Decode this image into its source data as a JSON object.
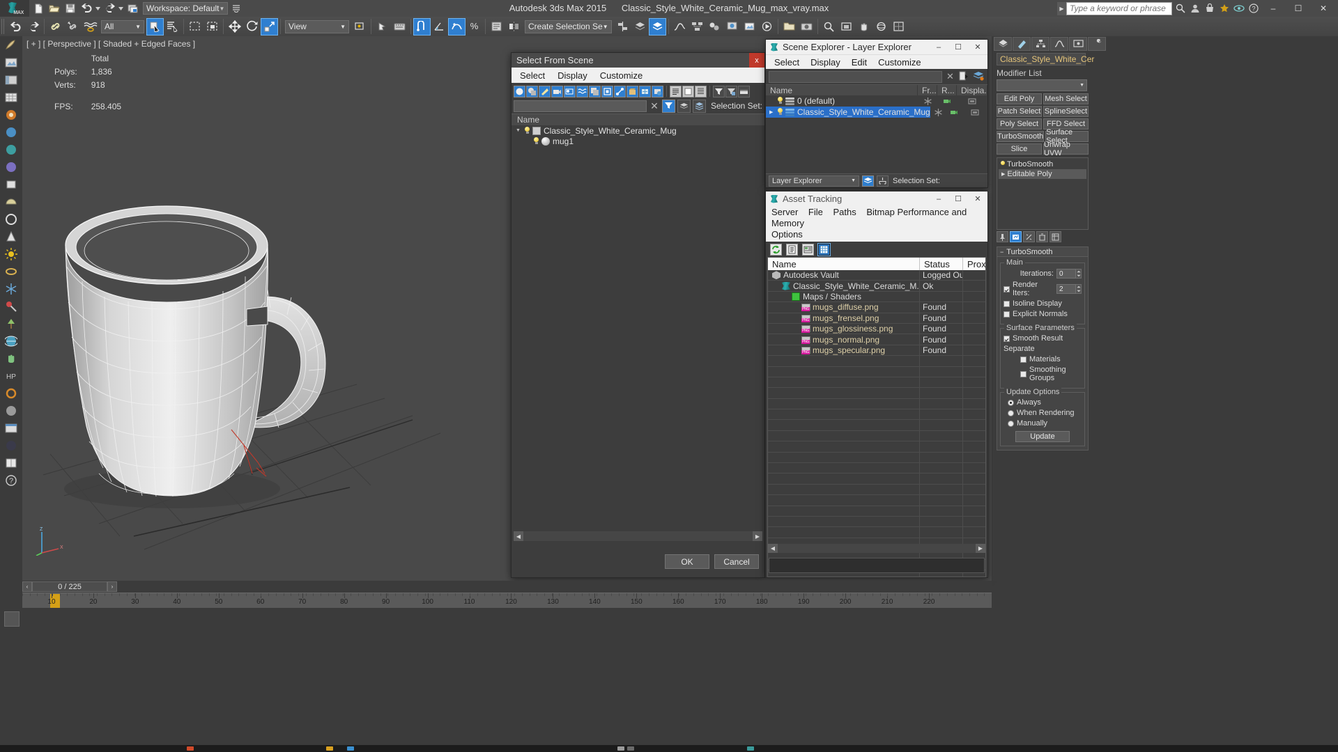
{
  "titlebar": {
    "workspace": "Workspace: Default",
    "product": "Autodesk 3ds Max  2015",
    "file": "Classic_Style_White_Ceramic_Mug_max_vray.max",
    "search_placeholder": "Type a keyword or phrase",
    "min": "–",
    "max": "☐",
    "close": "✕"
  },
  "toolbar": {
    "selection_filter": "All",
    "view_combo": "View",
    "named_selection_set": "Create Selection Se"
  },
  "viewport": {
    "label": "[ + ] [ Perspective ] [ Shaded + Edged Faces ]",
    "stats_header": "Total",
    "polys_label": "Polys:",
    "polys_value": "1,836",
    "verts_label": "Verts:",
    "verts_value": "918",
    "fps_label": "FPS:",
    "fps_value": "258.405"
  },
  "select_from_scene": {
    "title": "Select From Scene",
    "close": "x",
    "menu": [
      "Select",
      "Display",
      "Customize"
    ],
    "filter_value": "",
    "selection_set_label": "Selection Set:",
    "column_name": "Name",
    "tree": [
      {
        "label": "Classic_Style_White_Ceramic_Mug",
        "indent": 0,
        "expanded": true,
        "icon": "box-icon"
      },
      {
        "label": "mug1",
        "indent": 1,
        "expanded": false,
        "icon": "sphere-icon"
      }
    ],
    "ok": "OK",
    "cancel": "Cancel"
  },
  "scene_explorer": {
    "title": "Scene Explorer - Layer Explorer",
    "menu": [
      "Select",
      "Display",
      "Edit",
      "Customize"
    ],
    "filter_value": "",
    "columns": [
      "Name",
      "Fr...",
      "R...",
      "Displa..."
    ],
    "rows": [
      {
        "name": "0 (default)",
        "selected": false,
        "indent": 0,
        "color": "#b8b8b8"
      },
      {
        "name": "Classic_Style_White_Ceramic_Mug",
        "selected": true,
        "indent": 0,
        "color": "#2b7fd8"
      }
    ],
    "mode": "Layer Explorer",
    "selection_set_label": "Selection Set:",
    "min": "–",
    "max": "☐",
    "close": "✕"
  },
  "asset_tracking": {
    "title": "Asset Tracking",
    "menu": [
      "Server",
      "File",
      "Paths",
      "Bitmap Performance and Memory",
      "Options"
    ],
    "columns": [
      "Name",
      "Status",
      "Prox"
    ],
    "rows": [
      {
        "name": "Autodesk Vault",
        "status": "Logged Out ...",
        "icon": "vault-icon",
        "indent": 0
      },
      {
        "name": "Classic_Style_White_Ceramic_M...",
        "status": "Ok",
        "icon": "max-icon",
        "indent": 1
      },
      {
        "name": "Maps / Shaders",
        "status": "",
        "icon": "maps-icon",
        "indent": 2
      },
      {
        "name": "mugs_diffuse.png",
        "status": "Found",
        "icon": "png-icon",
        "indent": 3
      },
      {
        "name": "mugs_frensel.png",
        "status": "Found",
        "icon": "png-icon",
        "indent": 3
      },
      {
        "name": "mugs_glossiness.png",
        "status": "Found",
        "icon": "png-icon",
        "indent": 3
      },
      {
        "name": "mugs_normal.png",
        "status": "Found",
        "icon": "png-icon",
        "indent": 3
      },
      {
        "name": "mugs_specular.png",
        "status": "Found",
        "icon": "png-icon",
        "indent": 3
      }
    ],
    "min": "–",
    "max": "☐",
    "close": "✕"
  },
  "command_panel": {
    "object_name": "Classic_Style_White_Cer",
    "modifier_list_label": "Modifier List",
    "modifier_list_value": "",
    "buttons": [
      [
        "Edit Poly",
        "Mesh Select"
      ],
      [
        "Patch Select",
        "SplineSelect"
      ],
      [
        "Poly Select",
        "FFD Select"
      ],
      [
        "TurboSmooth",
        "Surface Select"
      ],
      [
        "Slice",
        "Unwrap UVW"
      ]
    ],
    "stack": [
      {
        "label": "TurboSmooth",
        "selected": false,
        "bulb": true
      },
      {
        "label": "Editable Poly",
        "selected": true,
        "bulb": false
      }
    ],
    "rollout_title": "TurboSmooth",
    "main_group": "Main",
    "iterations_label": "Iterations:",
    "iterations_value": "0",
    "render_iters_label": "Render Iters:",
    "render_iters_value": "2",
    "isoline_display": "Isoline Display",
    "explicit_normals": "Explicit Normals",
    "surface_params_group": "Surface Parameters",
    "smooth_result": "Smooth Result",
    "separate_label": "Separate",
    "materials": "Materials",
    "smoothing_groups": "Smoothing Groups",
    "update_options_group": "Update Options",
    "always": "Always",
    "when_rendering": "When Rendering",
    "manually": "Manually",
    "update_button": "Update"
  },
  "timebar": {
    "frame_field": "0 / 225",
    "prev": "‹",
    "next": "›",
    "ruler_labels": [
      "10",
      "20",
      "30",
      "40",
      "50",
      "60",
      "70",
      "80",
      "90",
      "100",
      "110",
      "120",
      "130",
      "140",
      "150",
      "160",
      "170",
      "180",
      "190",
      "200",
      "210",
      "220"
    ]
  },
  "colors": {
    "accent_blue": "#2f7fd0",
    "selection_blue": "#2a6fc9",
    "panel_bg": "#3d3d3d",
    "toolbar_bg": "#4a4a4a",
    "viewport_bg": "#494949",
    "close_red": "#c0392b",
    "object_name_text": "#e6c57a"
  }
}
